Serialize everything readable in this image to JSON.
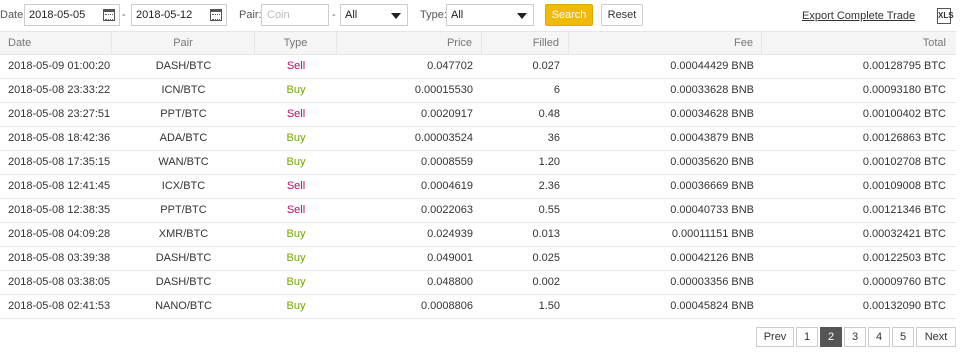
{
  "filters": {
    "date_label": "Date:",
    "date_from": "2018-05-05",
    "date_sep": "-",
    "date_to": "2018-05-12",
    "pair_label": "Pair:",
    "pair_placeholder": "Coin",
    "pair_sep": "-",
    "pair_quote": "All",
    "type_label": "Type:",
    "type_value": "All",
    "search_label": "Search",
    "reset_label": "Reset",
    "export_label": "Export Complete Trade History",
    "export_icon": "XLS"
  },
  "table": {
    "headers": [
      "Date",
      "Pair",
      "Type",
      "Price",
      "Filled",
      "Fee",
      "Total"
    ],
    "rows": [
      {
        "date": "2018-05-09 01:00:20",
        "pair": "DASH/BTC",
        "type": "Sell",
        "price": "0.047702",
        "filled": "0.027",
        "fee": "0.00044429 BNB",
        "total": "0.00128795 BTC"
      },
      {
        "date": "2018-05-08 23:33:22",
        "pair": "ICN/BTC",
        "type": "Buy",
        "price": "0.00015530",
        "filled": "6",
        "fee": "0.00033628 BNB",
        "total": "0.00093180 BTC"
      },
      {
        "date": "2018-05-08 23:27:51",
        "pair": "PPT/BTC",
        "type": "Sell",
        "price": "0.0020917",
        "filled": "0.48",
        "fee": "0.00034628 BNB",
        "total": "0.00100402 BTC"
      },
      {
        "date": "2018-05-08 18:42:36",
        "pair": "ADA/BTC",
        "type": "Buy",
        "price": "0.00003524",
        "filled": "36",
        "fee": "0.00043879 BNB",
        "total": "0.00126863 BTC"
      },
      {
        "date": "2018-05-08 17:35:15",
        "pair": "WAN/BTC",
        "type": "Buy",
        "price": "0.0008559",
        "filled": "1.20",
        "fee": "0.00035620 BNB",
        "total": "0.00102708 BTC"
      },
      {
        "date": "2018-05-08 12:41:45",
        "pair": "ICX/BTC",
        "type": "Sell",
        "price": "0.0004619",
        "filled": "2.36",
        "fee": "0.00036669 BNB",
        "total": "0.00109008 BTC"
      },
      {
        "date": "2018-05-08 12:38:35",
        "pair": "PPT/BTC",
        "type": "Sell",
        "price": "0.0022063",
        "filled": "0.55",
        "fee": "0.00040733 BNB",
        "total": "0.00121346 BTC"
      },
      {
        "date": "2018-05-08 04:09:28",
        "pair": "XMR/BTC",
        "type": "Buy",
        "price": "0.024939",
        "filled": "0.013",
        "fee": "0.00011151 BNB",
        "total": "0.00032421 BTC"
      },
      {
        "date": "2018-05-08 03:39:38",
        "pair": "DASH/BTC",
        "type": "Buy",
        "price": "0.049001",
        "filled": "0.025",
        "fee": "0.00042126 BNB",
        "total": "0.00122503 BTC"
      },
      {
        "date": "2018-05-08 03:38:05",
        "pair": "DASH/BTC",
        "type": "Buy",
        "price": "0.048800",
        "filled": "0.002",
        "fee": "0.00003356 BNB",
        "total": "0.00009760 BTC"
      },
      {
        "date": "2018-05-08 02:41:53",
        "pair": "NANO/BTC",
        "type": "Buy",
        "price": "0.0008806",
        "filled": "1.50",
        "fee": "0.00045824 BNB",
        "total": "0.00132090 BTC"
      }
    ]
  },
  "pagination": {
    "prev_label": "Prev",
    "pages": [
      "1",
      "2",
      "3",
      "4",
      "5"
    ],
    "current_page": "2",
    "next_label": "Next"
  },
  "colors": {
    "accent": "#f0b90b",
    "sell": "#d0006f",
    "buy": "#70a800"
  },
  "icons": {
    "calendar": "calendar-icon",
    "dropdown": "chevron-down-icon",
    "export": "excel-icon"
  }
}
